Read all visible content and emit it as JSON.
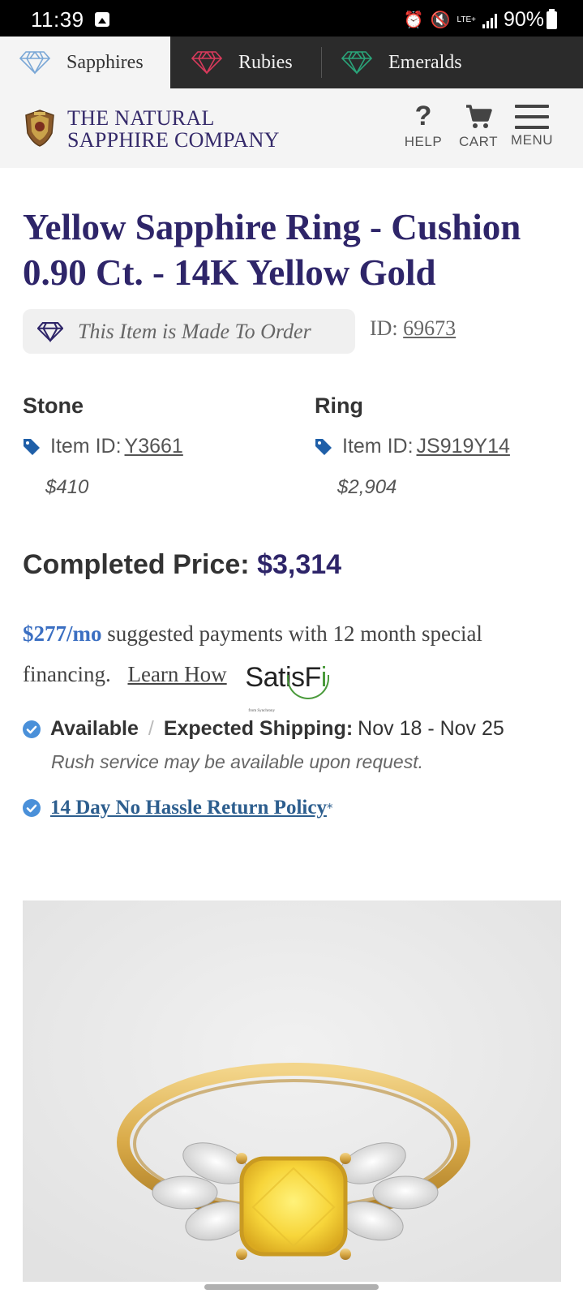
{
  "status_bar": {
    "time": "11:39",
    "lte": "LTE+",
    "battery": "90%"
  },
  "gem_tabs": [
    {
      "label": "Sapphires",
      "icon": "diamond-outline-icon",
      "color": "#7aa7d6",
      "active": true
    },
    {
      "label": "Rubies",
      "icon": "diamond-outline-icon",
      "color": "#d93a5c",
      "active": false
    },
    {
      "label": "Emeralds",
      "icon": "diamond-outline-icon",
      "color": "#2aa57a",
      "active": false
    }
  ],
  "header": {
    "brand_line1": "THE NATURAL",
    "brand_line2": "SAPPHIRE COMPANY",
    "help_label": "HELP",
    "cart_label": "CART",
    "menu_label": "MENU"
  },
  "product": {
    "title": "Yellow Sapphire Ring - Cushion 0.90 Ct. - 14K Yellow Gold",
    "made_to_order": "This Item is Made To Order",
    "id_label": "ID:",
    "id_value": "69673",
    "stone": {
      "heading": "Stone",
      "item_id_label": "Item ID:",
      "item_id": "Y3661",
      "price": "$410"
    },
    "ring": {
      "heading": "Ring",
      "item_id_label": "Item ID:",
      "item_id": "JS919Y14",
      "price": "$2,904"
    },
    "completed_label": "Completed Price:",
    "completed_price": "$3,314"
  },
  "financing": {
    "monthly": "$277/mo",
    "text": "suggested payments with 12 month special financing.",
    "learn_how": "Learn How",
    "provider_logo_text": "SatisFi",
    "provider_sub": "from Synchrony"
  },
  "availability": {
    "status": "Available",
    "separator": "/",
    "shipping_label": "Expected Shipping:",
    "shipping_dates": "Nov 18 - Nov 25",
    "rush_note": "Rush service may be available upon request.",
    "return_policy": "14 Day No Hassle Return Policy",
    "return_mark": "*"
  },
  "colors": {
    "brand_navy": "#2e2569",
    "link_blue": "#2d5e8e",
    "tag_blue": "#1f5fa8",
    "check_blue": "#4a90d9"
  }
}
